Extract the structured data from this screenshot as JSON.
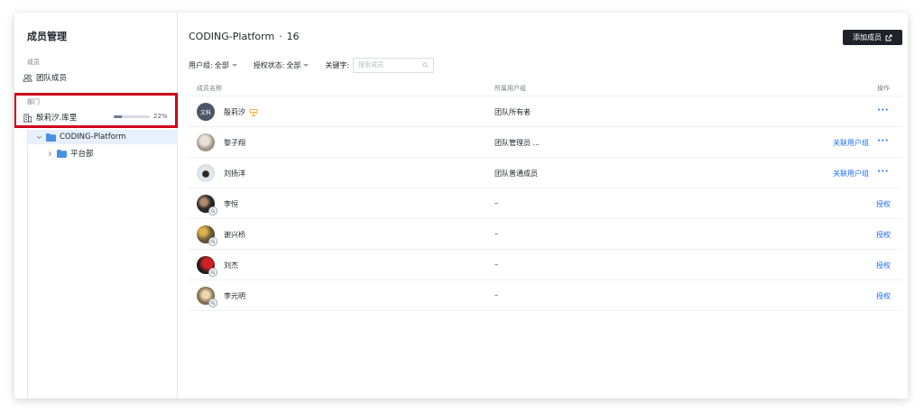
{
  "sidebar": {
    "title": "成员管理",
    "section_members": "成员",
    "team_members": "团队成员",
    "section_departments": "部门",
    "company": {
      "name": "殷莉汐.库里",
      "quota_percent": 22,
      "quota_text": "22%"
    },
    "tree": [
      {
        "label": "CODING-Platform",
        "expanded": true,
        "selected": true
      },
      {
        "label": "平台部",
        "expanded": false,
        "selected": false
      }
    ]
  },
  "header": {
    "title": "CODING-Platform",
    "separator": "·",
    "count": "16",
    "add_button": "添加成员"
  },
  "filters": {
    "group_label": "用户组:",
    "group_value": "全部",
    "auth_label": "授权状态:",
    "auth_value": "全部",
    "keyword_label": "关键字:",
    "search_placeholder": "搜索成员"
  },
  "table": {
    "columns": {
      "name": "成员名称",
      "group": "所属用户组",
      "action": "操作"
    },
    "rows": [
      {
        "name": "殷莉汐",
        "avatar_text": "文科",
        "group": "团队所有者",
        "link": "",
        "more": "···",
        "owner": true
      },
      {
        "name": "黎子翔",
        "group": "团队管理员 ...",
        "link": "关联用户组",
        "more": "···"
      },
      {
        "name": "刘扬洋",
        "group": "团队普通成员",
        "link": "关联用户组",
        "more": "···"
      },
      {
        "name": "李恒",
        "group": "–",
        "link": "授权",
        "more": ""
      },
      {
        "name": "谢兴桥",
        "group": "–",
        "link": "授权",
        "more": ""
      },
      {
        "name": "刘杰",
        "group": "–",
        "link": "授权",
        "more": ""
      },
      {
        "name": "李元明",
        "group": "–",
        "link": "授权",
        "more": ""
      }
    ]
  },
  "colors": {
    "accent": "#1d6ef2",
    "primary_button": "#1f2329",
    "highlight_box": "#d0021b",
    "selected_row": "#e8f0fd",
    "folder": "#4a90e2",
    "owner_icon": "#f5a623"
  }
}
